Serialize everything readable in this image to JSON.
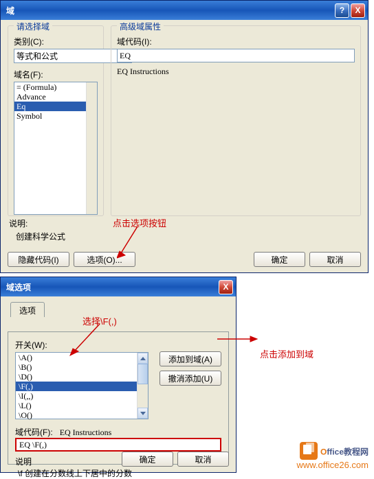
{
  "dlg1": {
    "title": "域",
    "help_label": "?",
    "close_label": "X",
    "left_group": "请选择域",
    "right_group": "高级域属性",
    "category_label": "类别(C):",
    "category_value": "等式和公式",
    "fieldname_label": "域名(F):",
    "fieldnames": [
      "= (Formula)",
      "Advance",
      "Eq",
      "Symbol"
    ],
    "fieldcode_label": "域代码(I):",
    "fieldcode_value": "EQ",
    "fieldcode_hint": "EQ Instructions",
    "desc_label": "说明:",
    "desc_value": "创建科学公式",
    "hide_codes_btn": "隐藏代码(I)",
    "options_btn": "选项(O)...",
    "ok_btn": "确定",
    "cancel_btn": "取消"
  },
  "anno": {
    "click_options": "点击选项按钮",
    "select_f": "选择\\F(,)",
    "click_add": "点击添加到域"
  },
  "dlg2": {
    "title": "域选项",
    "close_label": "X",
    "tab_label": "选项",
    "switch_label": "开关(W):",
    "switches": [
      "\\A()",
      "\\B()",
      "\\D()",
      "\\F(,)",
      "\\I(,,)",
      "\\L()",
      "\\O()"
    ],
    "add_btn": "添加到域(A)",
    "undo_btn": "撤消添加(U)",
    "fieldcodes_label": "域代码(F):",
    "fieldcodes_hint": "EQ Instructions",
    "fieldcode_value": "EQ \\F(,)",
    "desc_label": "说明",
    "desc_value": "\\f 创建在分数线上下居中的分数",
    "ok_btn": "确定",
    "cancel_btn": "取消"
  },
  "watermark": {
    "brand_prefix": "O",
    "brand_rest": "ffice教程网",
    "url": "www.office26.com"
  }
}
